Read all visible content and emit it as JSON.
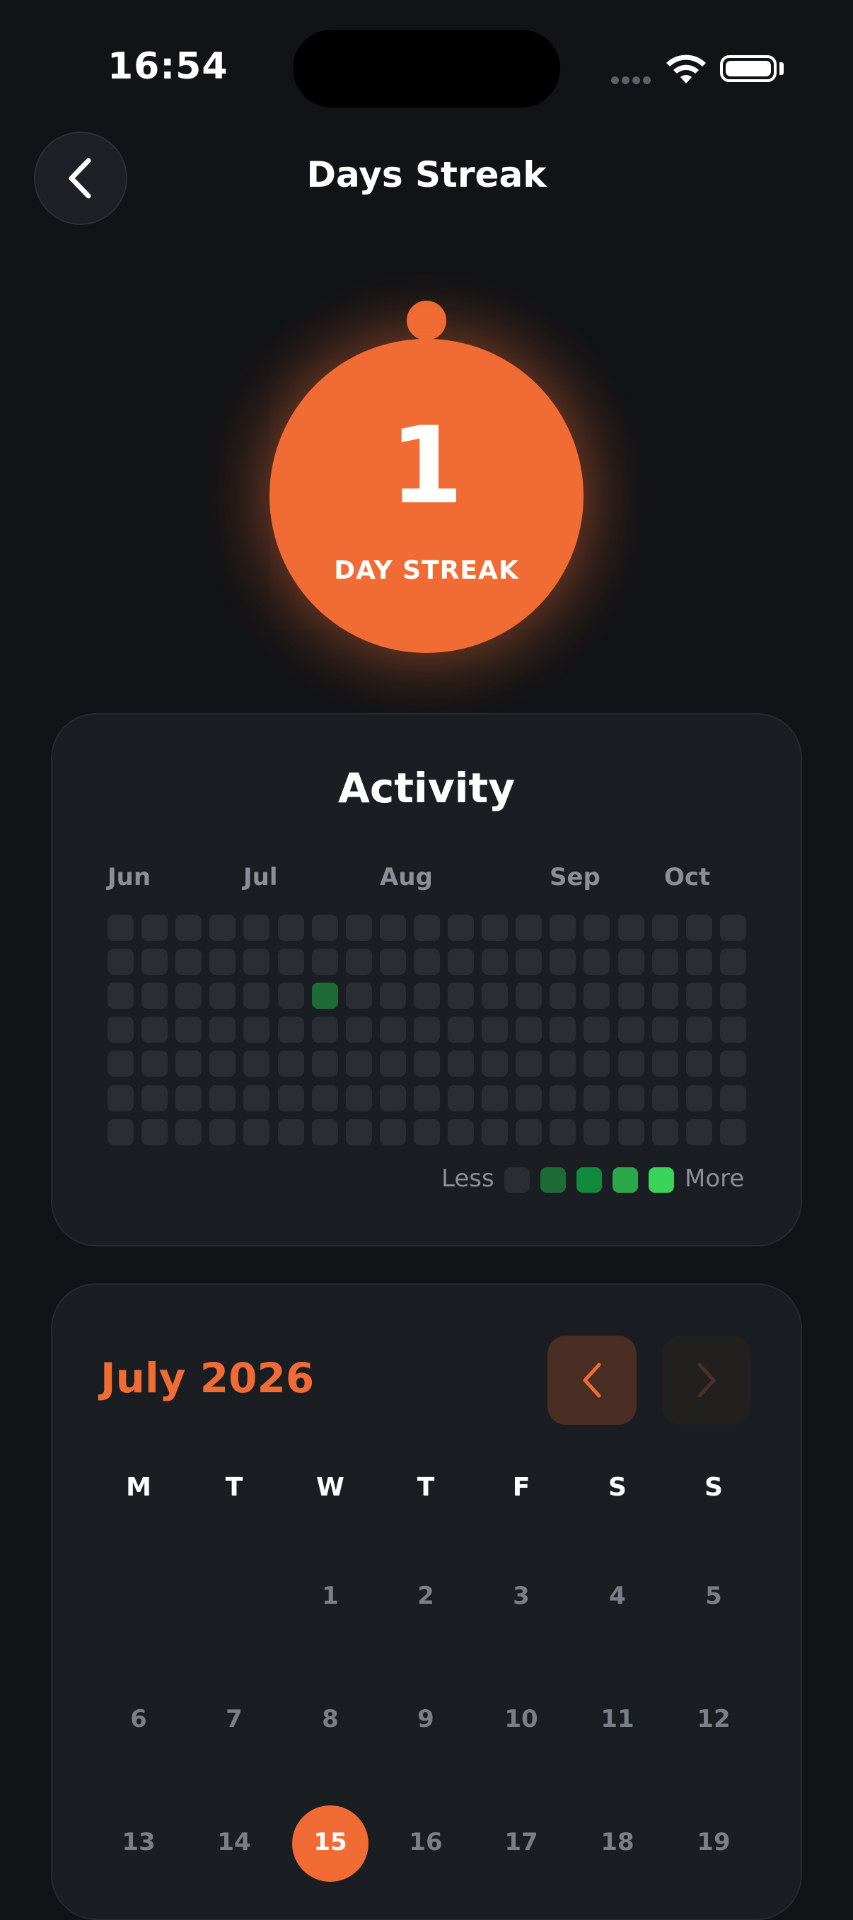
{
  "status_bar": {
    "time": "16:54"
  },
  "header": {
    "title": "Days Streak"
  },
  "streak": {
    "count": "1",
    "label": "DAY STREAK"
  },
  "activity": {
    "title": "Activity",
    "months": [
      "Jun",
      "Jul",
      "Aug",
      "Sep",
      "Oct"
    ],
    "grid": {
      "rows": 7,
      "columns": 19,
      "active_cells": [
        {
          "row": 2,
          "col": 6,
          "level": 1
        }
      ]
    },
    "legend": {
      "less": "Less",
      "more": "More"
    },
    "colors": {
      "empty": "#2a2d33",
      "levels": [
        "#2a2d33",
        "#1f6b38",
        "#118a3d",
        "#2aa84a",
        "#3ad258"
      ]
    }
  },
  "calendar": {
    "title": "July 2026",
    "weekdays": [
      "M",
      "T",
      "W",
      "T",
      "F",
      "S",
      "S"
    ],
    "weeks": [
      [
        "",
        "",
        "1",
        "2",
        "3",
        "4",
        "5"
      ],
      [
        "6",
        "7",
        "8",
        "9",
        "10",
        "11",
        "12"
      ],
      [
        "13",
        "14",
        "15",
        "16",
        "17",
        "18",
        "19"
      ]
    ],
    "today": "15"
  },
  "colors": {
    "accent": "#f06c34",
    "background": "#121316",
    "card": "#1a1d22"
  }
}
